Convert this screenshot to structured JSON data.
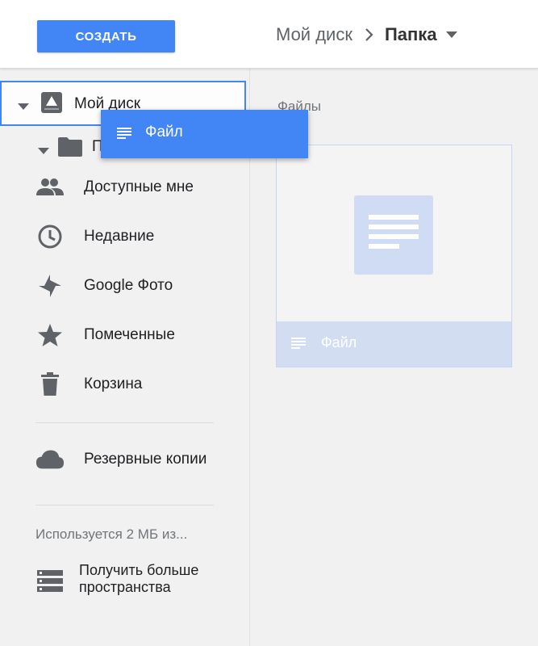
{
  "header": {
    "create_label": "СОЗДАТЬ",
    "breadcrumb": {
      "root": "Мой диск",
      "current": "Папка"
    }
  },
  "sidebar": {
    "my_drive": {
      "label": "Мой диск",
      "icon": "drive-icon"
    },
    "folder": {
      "label": "П",
      "icon": "folder-icon"
    },
    "items": [
      {
        "label": "Доступные мне",
        "icon": "people-icon"
      },
      {
        "label": "Недавние",
        "icon": "clock-icon"
      },
      {
        "label": "Google Фото",
        "icon": "pinwheel-icon"
      },
      {
        "label": "Помеченные",
        "icon": "star-icon"
      },
      {
        "label": "Корзина",
        "icon": "trash-icon"
      },
      {
        "label": "Резервные копии",
        "icon": "cloud-icon"
      }
    ],
    "storage_usage": "Используется 2 МБ из...",
    "get_more_storage": "Получить больше пространства"
  },
  "main": {
    "section_label": "Файлы",
    "files": [
      {
        "name": "Файл",
        "icon": "document-icon"
      }
    ]
  },
  "drag_chip": {
    "label": "Файл",
    "icon": "document-icon"
  },
  "colors": {
    "accent": "#4285f4",
    "icon_gray": "#5f6368",
    "card_highlight": "#d3ddf2"
  }
}
